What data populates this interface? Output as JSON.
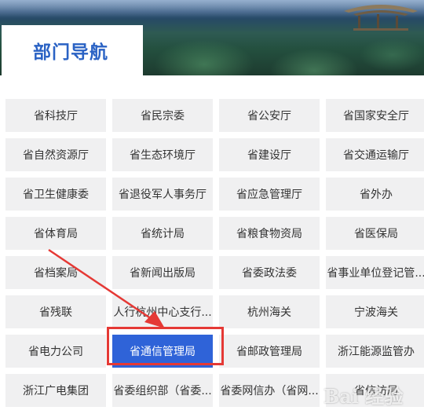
{
  "section": {
    "title": "部门导航"
  },
  "departments": [
    "省科技厅",
    "省民宗委",
    "省公安厅",
    "省国家安全厅",
    "省自然资源厅",
    "省生态环境厅",
    "省建设厅",
    "省交通运输厅",
    "省卫生健康委",
    "省退役军人事务厅",
    "省应急管理厅",
    "省外办",
    "省体育局",
    "省统计局",
    "省粮食物资局",
    "省医保局",
    "省档案局",
    "省新闻出版局",
    "省委政法委",
    "省事业单位登记管...",
    "省残联",
    "人行杭州中心支行...",
    "杭州海关",
    "宁波海关",
    "省电力公司",
    "省通信管理局",
    "省邮政管理局",
    "浙江能源监管办",
    "浙江广电集团",
    "省委组织部（省委...",
    "省委网信办（省网...",
    "省信访局"
  ],
  "selected_department": "省通信管理局",
  "annotation": {
    "color": "#e53935",
    "accent": "#2f63d8"
  },
  "watermark": {
    "text": "Bai 经验"
  }
}
